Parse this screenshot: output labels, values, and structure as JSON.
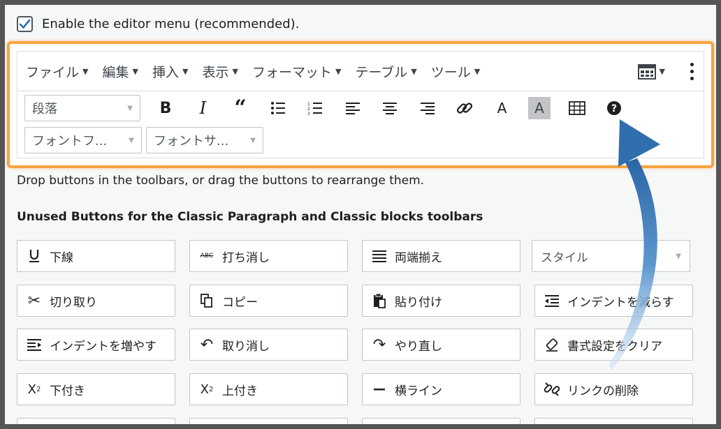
{
  "checkbox": {
    "label": "Enable the editor menu (recommended).",
    "checked": true
  },
  "menubar": {
    "items": [
      "ファイル",
      "編集",
      "挿入",
      "表示",
      "フォーマット",
      "テーブル",
      "ツール"
    ]
  },
  "toolbar": {
    "paragraph_select": "段落",
    "font_family_select": "フォントフ...",
    "font_size_select": "フォントサ..."
  },
  "description": "Drop buttons in the toolbars, or drag the buttons to rearrange them.",
  "unused_title": "Unused Buttons for the Classic Paragraph and Classic blocks toolbars",
  "unused_buttons": [
    [
      "下線",
      "打ち消し",
      "両端揃え",
      "スタイル"
    ],
    [
      "切り取り",
      "コピー",
      "貼り付け",
      "インデントを減らす"
    ],
    [
      "インデントを増やす",
      "取り消し",
      "やり直し",
      "書式設定をクリア"
    ],
    [
      "下付き",
      "上付き",
      "横ライン",
      "リンクの削除"
    ]
  ],
  "colors": {
    "highlight": "#f6a341",
    "arrow": "#2f6fad",
    "checkbox": "#2271b1"
  }
}
